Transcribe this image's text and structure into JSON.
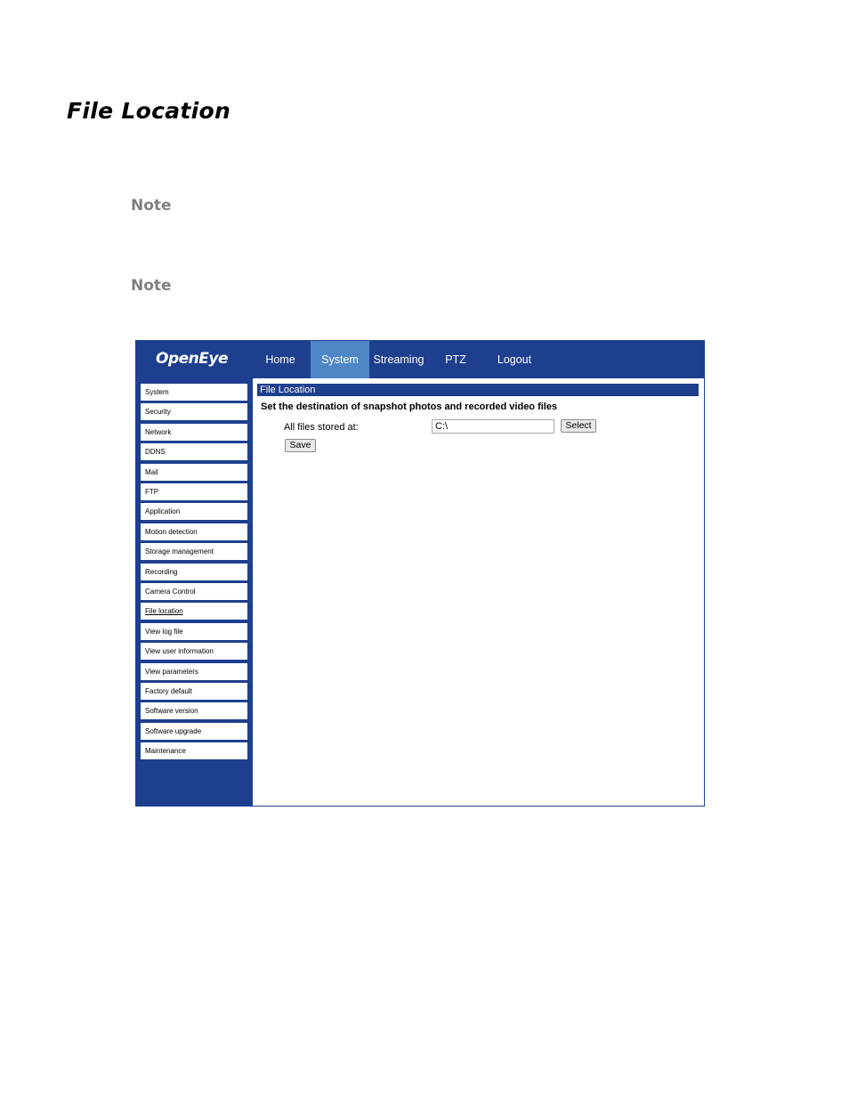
{
  "document": {
    "title": "File Location",
    "notes": [
      "Note",
      "Note"
    ]
  },
  "app": {
    "logo": "OpenEye",
    "nav": [
      {
        "label": "Home",
        "active": false
      },
      {
        "label": "System",
        "active": true
      },
      {
        "label": "Streaming",
        "active": false
      },
      {
        "label": "PTZ",
        "active": false
      },
      {
        "label": "Logout",
        "active": false
      }
    ],
    "sidebar": {
      "items": [
        {
          "label": "System"
        },
        {
          "label": "Security"
        },
        {
          "label": "Network"
        },
        {
          "label": "DDNS"
        },
        {
          "label": "Mail"
        },
        {
          "label": "FTP"
        },
        {
          "label": "Application"
        },
        {
          "label": "Motion detection"
        },
        {
          "label": "Storage management"
        },
        {
          "label": "Recording"
        },
        {
          "label": "Camera Control"
        },
        {
          "label": "File location",
          "current": true
        },
        {
          "label": "View log file"
        },
        {
          "label": "View user information"
        },
        {
          "label": "View parameters"
        },
        {
          "label": "Factory default"
        },
        {
          "label": "Software version"
        },
        {
          "label": "Software upgrade"
        },
        {
          "label": "Maintenance"
        }
      ]
    },
    "content": {
      "header": "File Location",
      "description": "Set the destination of snapshot photos and recorded video files",
      "field_label": "All files stored at:",
      "field_value": "C:\\",
      "select_label": "Select",
      "save_label": "Save"
    }
  }
}
